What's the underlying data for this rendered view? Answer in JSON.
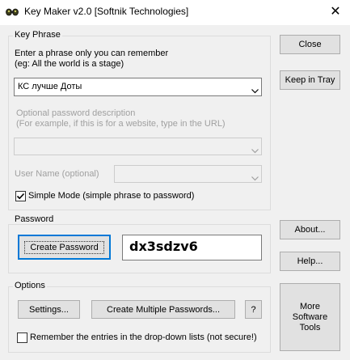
{
  "window": {
    "title": "Key Maker v2.0 [Softnik Technologies]",
    "close_glyph": "✕",
    "icon": "key-maker-app-icon"
  },
  "key_phrase": {
    "group_label": "Key Phrase",
    "instruction_line1": "Enter a phrase only you can remember",
    "instruction_line2": "(eg: All the world is a stage)",
    "phrase_value": "КС лучше Доты",
    "desc_label_line1": "Optional password description",
    "desc_label_line2": "(For example, if this is for a website, type in the URL)",
    "desc_value": "",
    "username_label": "User Name (optional)",
    "username_value": "",
    "simple_mode_label": "Simple Mode (simple phrase to password)",
    "simple_mode_checked": true
  },
  "password": {
    "group_label": "Password",
    "create_button": "Create Password",
    "generated": "dx3sdzv6"
  },
  "options": {
    "group_label": "Options",
    "settings_button": "Settings...",
    "multiple_button": "Create Multiple Passwords...",
    "help_q_button": "?",
    "remember_label": "Remember the entries in the drop-down lists (not secure!)",
    "remember_checked": false
  },
  "side": {
    "close_button": "Close",
    "tray_button": "Keep in Tray",
    "about_button": "About...",
    "help_button": "Help...",
    "more_line1": "More",
    "more_line2": "Software",
    "more_line3": "Tools"
  },
  "colors": {
    "background": "#f0f0f0",
    "accent": "#0078d7",
    "check": "#000000"
  },
  "icons": {
    "dropdown": "chevron-down-icon",
    "check": "check-icon"
  }
}
